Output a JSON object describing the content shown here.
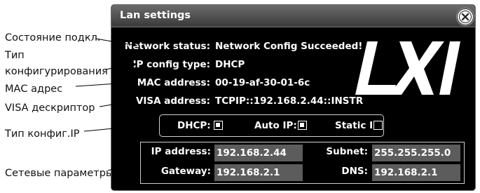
{
  "annotations": {
    "connection_status": "Состояние подкл.",
    "config_type_line1": "Тип",
    "config_type_line2": "конфигурирования",
    "mac_address": "МАС адрес",
    "visa_descriptor": "VISA дескриптор",
    "ip_config_type": "Тип конфиг.IP",
    "network_params": "Сетевые параметры"
  },
  "dialog": {
    "title": "Lan settings",
    "close_icon": "close-icon",
    "logo_text": "LXI",
    "network_status": {
      "label": "Network status:",
      "value": "Network Config Succeeded!"
    },
    "ip_config_type": {
      "label": "IP config type:",
      "value": "DHCP"
    },
    "mac_address": {
      "label": "MAC address:",
      "value": "00-19-af-30-01-6c"
    },
    "visa_address": {
      "label": "VISA address:",
      "value": "TCPIP::192.168.2.44::INSTR"
    },
    "ip_type": {
      "dhcp": {
        "label": "DHCP:",
        "checked": true
      },
      "auto_ip": {
        "label": "Auto IP:",
        "checked": true
      },
      "static_ip": {
        "label": "Static IP:",
        "checked": false
      }
    },
    "network": {
      "ip_address": {
        "label": "IP address:",
        "value": "192.168.2.44"
      },
      "subnet": {
        "label": "Subnet:",
        "value": "255.255.255.0"
      },
      "gateway": {
        "label": "Gateway:",
        "value": "192.168.2.1"
      },
      "dns": {
        "label": "DNS:",
        "value": "192.168.2.1"
      }
    }
  }
}
